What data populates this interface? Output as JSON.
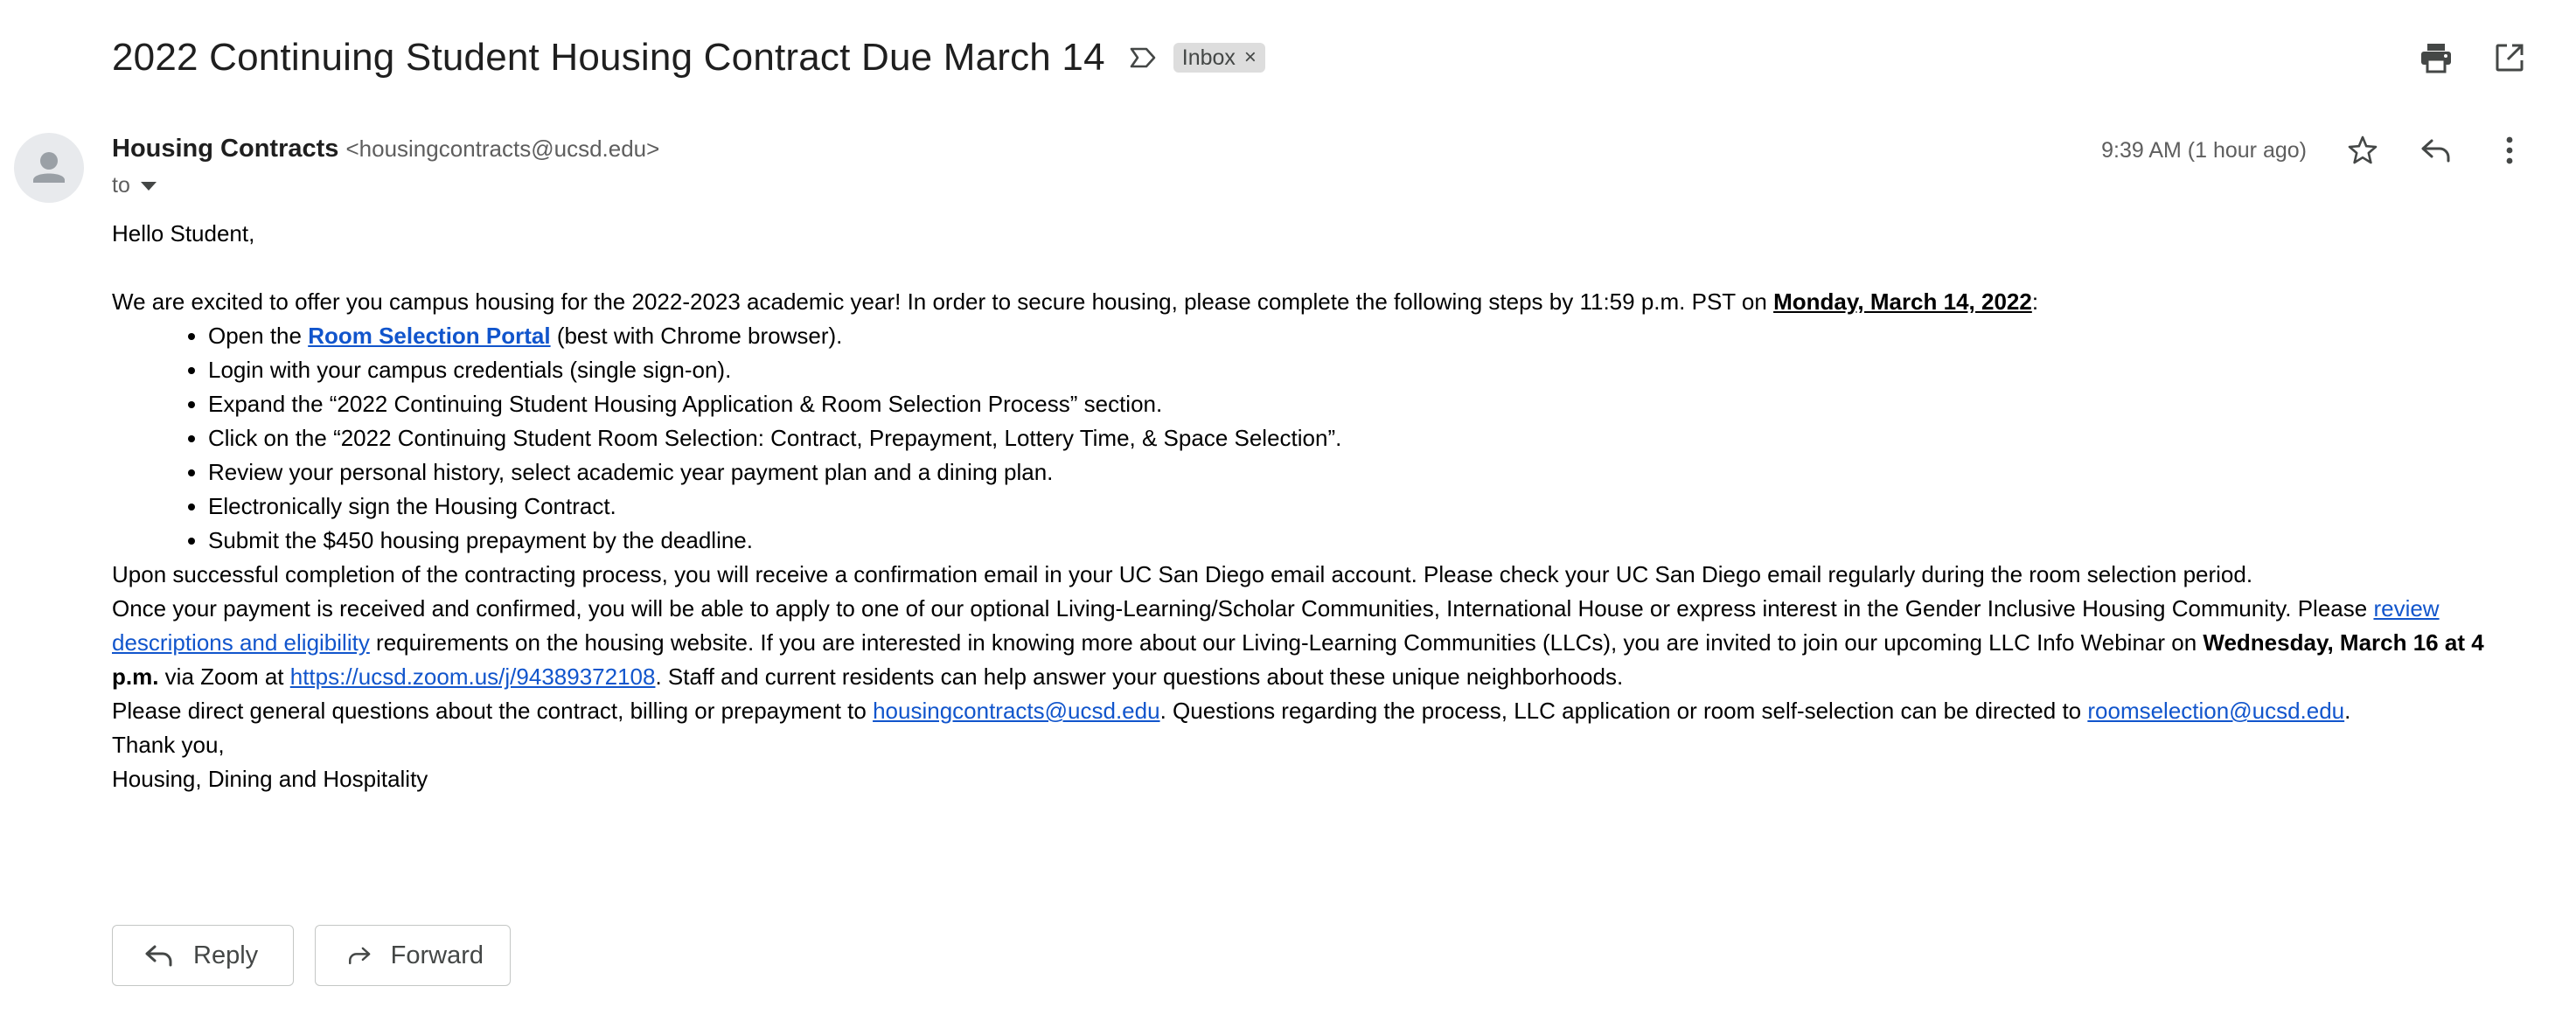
{
  "header": {
    "subject": "2022 Continuing Student Housing Contract Due March 14",
    "chip_label": "Inbox",
    "chip_close": "×"
  },
  "sender": {
    "name": "Housing Contracts",
    "email": "<housingcontracts@ucsd.edu>",
    "to_label": "to",
    "timestamp": "9:39 AM (1 hour ago)"
  },
  "body": {
    "greeting": "Hello Student,",
    "intro_prefix": "We are excited to offer you campus housing for the 2022-2023 academic year! In order to secure housing, please complete the following steps by 11:59 p.m. PST on ",
    "intro_deadline": "Monday, March 14, 2022",
    "intro_suffix": ":",
    "step1_prefix": "Open the ",
    "step1_link": "Room Selection Portal",
    "step1_suffix": " (best with Chrome browser).",
    "steps": [
      "Login with your campus credentials (single sign-on).",
      "Expand the “2022 Continuing Student Housing Application & Room Selection Process” section.",
      "Click on the “2022 Continuing Student Room Selection: Contract, Prepayment, Lottery Time, & Space Selection”.",
      "Review your personal history, select academic year payment plan and a dining plan.",
      "Electronically sign the Housing Contract.",
      "Submit the $450 housing prepayment by the deadline."
    ],
    "confirmation": "Upon successful completion of the contracting process, you will receive a confirmation email in your UC San Diego email account. Please check your UC San Diego email regularly during the room selection period.",
    "llc_prefix": "Once your payment is received and confirmed, you will be able to apply to one of our optional Living-Learning/Scholar Communities, International House or express interest in the Gender Inclusive Housing Community. Please ",
    "llc_link": "review descriptions and eligibility",
    "llc_mid": " requirements on the housing website. If you are interested in knowing more about our Living-Learning Communities (LLCs), you are invited to join our upcoming LLC Info Webinar on ",
    "llc_date": "Wednesday, March 16 at 4 p.m.",
    "llc_zoom_prefix": " via Zoom at ",
    "llc_zoom_link": "https://ucsd.zoom.us/j/94389372108",
    "llc_suffix": ". Staff and current residents can help answer your questions about these unique neighborhoods.",
    "contact_prefix": "Please direct general questions about the contract, billing or prepayment to ",
    "contact_email1": "housingcontracts@ucsd.edu",
    "contact_mid": ". Questions regarding the process, LLC application or room self-selection can be directed to ",
    "contact_email2": "roomselection@ucsd.edu",
    "contact_suffix": ".",
    "thanks": "Thank you,",
    "signature": "Housing, Dining and Hospitality"
  },
  "actions": {
    "reply_label": "Reply",
    "forward_label": "Forward"
  },
  "icons": {
    "label": "label-outline-icon",
    "print": "print-icon",
    "open_new": "open-in-new-window-icon",
    "star": "star-outline-icon",
    "reply": "reply-icon",
    "more": "more-vertical-icon",
    "avatar": "person-avatar-icon",
    "forward": "forward-icon"
  },
  "colors": {
    "link": "#1155cc",
    "chip_bg": "#dddddd",
    "avatar_bg": "#e8eaed"
  }
}
